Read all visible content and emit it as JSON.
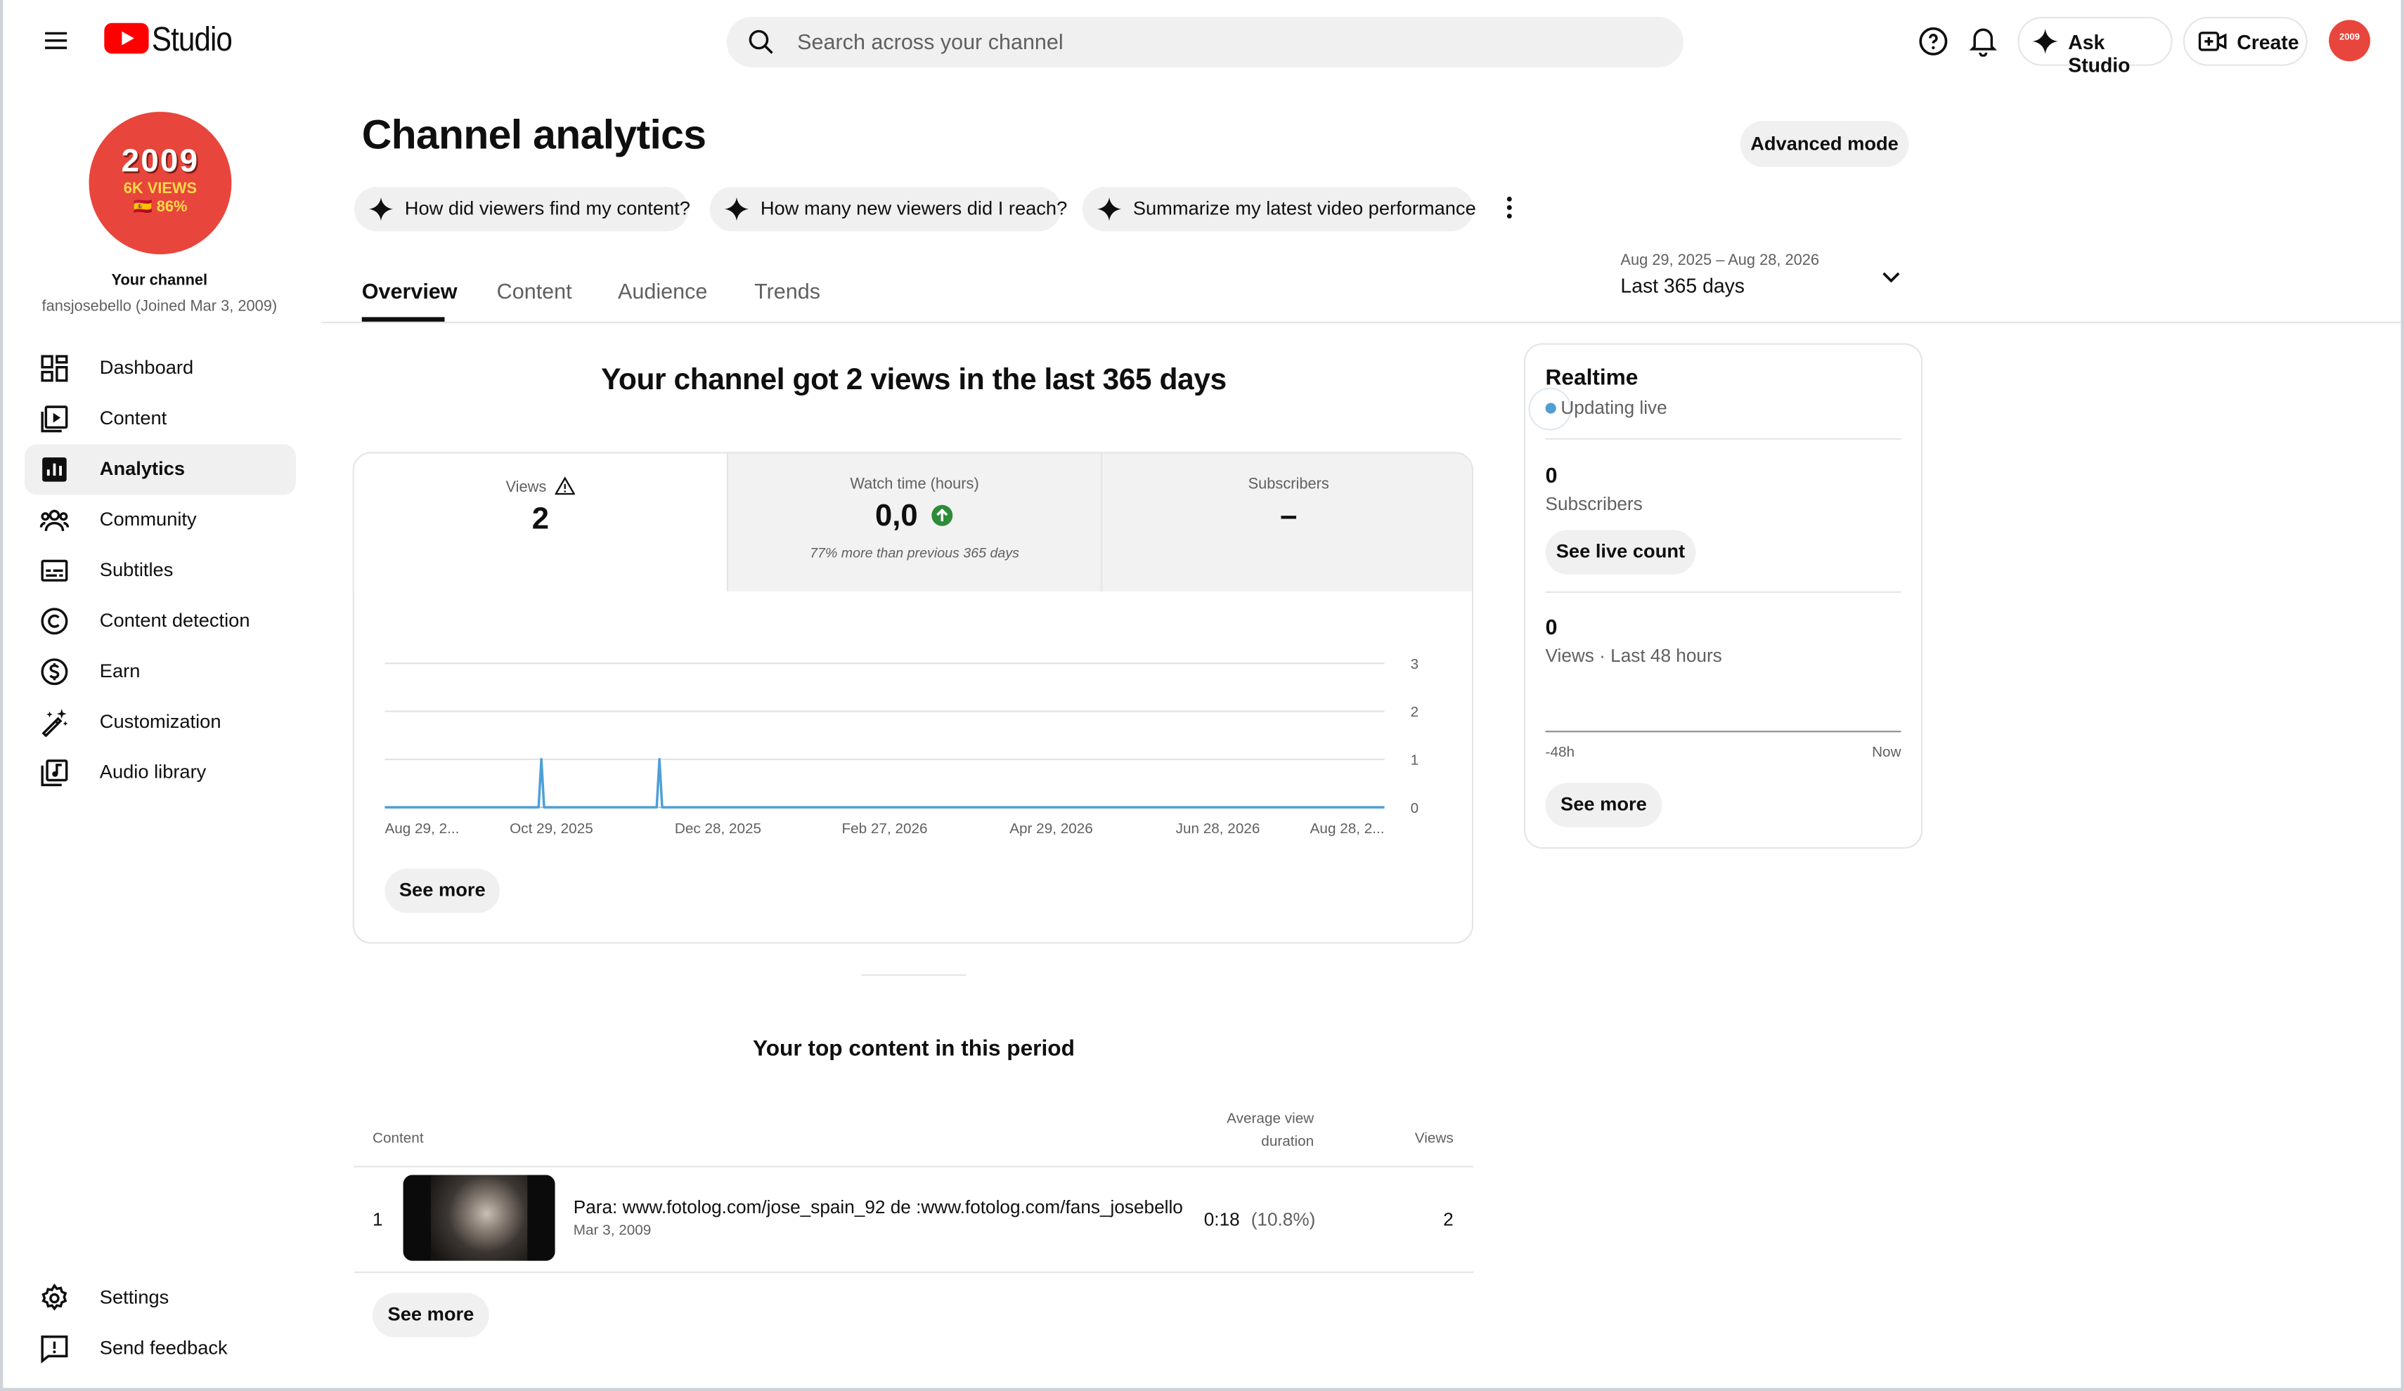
{
  "header": {
    "brand": "Studio",
    "search_placeholder": "Search across your channel",
    "ask_studio": "Ask Studio",
    "create": "Create",
    "avatar_text": "2009"
  },
  "sidebar": {
    "avatar_line1": "2009",
    "avatar_line2": "6K VIEWS",
    "avatar_line3": "🇪🇸 86%",
    "channel_label": "Your channel",
    "channel_sub": "fansjosebello (Joined Mar 3, 2009)",
    "items": [
      {
        "label": "Dashboard",
        "icon": "dashboard-icon"
      },
      {
        "label": "Content",
        "icon": "content-icon"
      },
      {
        "label": "Analytics",
        "icon": "analytics-icon"
      },
      {
        "label": "Community",
        "icon": "community-icon"
      },
      {
        "label": "Subtitles",
        "icon": "subtitles-icon"
      },
      {
        "label": "Content detection",
        "icon": "copyright-icon"
      },
      {
        "label": "Earn",
        "icon": "dollar-icon"
      },
      {
        "label": "Customization",
        "icon": "magic-wand-icon"
      },
      {
        "label": "Audio library",
        "icon": "audio-library-icon"
      }
    ],
    "settings": "Settings",
    "feedback": "Send feedback"
  },
  "main": {
    "title": "Channel analytics",
    "advanced_mode": "Advanced mode",
    "chips": [
      "How did viewers find my content?",
      "How many new viewers did I reach?",
      "Summarize my latest video performance"
    ],
    "tabs": [
      "Overview",
      "Content",
      "Audience",
      "Trends"
    ],
    "active_tab": "Overview",
    "date_range": "Aug 29, 2025 – Aug 28, 2026",
    "date_preset": "Last 365 days",
    "headline": "Your channel got 2 views in the last 365 days",
    "metrics": [
      {
        "label": "Views",
        "value": "2"
      },
      {
        "label": "Watch time (hours)",
        "value": "0,0",
        "note": "77% more than previous 365 days"
      },
      {
        "label": "Subscribers",
        "value": "–"
      }
    ],
    "see_more": "See more",
    "top_content": {
      "title": "Your top content in this period",
      "col_content": "Content",
      "col_avd_line1": "Average view",
      "col_avd_line2": "duration",
      "col_views": "Views",
      "rows": [
        {
          "rank": "1",
          "title": "Para: www.fotolog.com/jose_spain_92 de :www.fotolog.com/fans_josebello",
          "date": "Mar 3, 2009",
          "avd": "0:18",
          "avd_pct": "(10.8%)",
          "views": "2"
        }
      ],
      "see_more": "See more"
    }
  },
  "realtime": {
    "title": "Realtime",
    "status": "Updating live",
    "subs_value": "0",
    "subs_label": "Subscribers",
    "live_count": "See live count",
    "views_value": "0",
    "views_label": "Views · Last 48 hours",
    "axis_left": "-48h",
    "axis_right": "Now",
    "see_more": "See more"
  },
  "chart_data": {
    "type": "line",
    "x_ticks": [
      "Aug 29, 2...",
      "Oct 29, 2025",
      "Dec 28, 2025",
      "Feb 27, 2026",
      "Apr 29, 2026",
      "Jun 28, 2026",
      "Aug 28, 2..."
    ],
    "y_ticks": [
      "3",
      "2",
      "1",
      "0"
    ],
    "ylim": [
      0,
      3
    ],
    "series": [
      {
        "values": [
          {
            "x": "2025-10-25",
            "y": 1
          },
          {
            "x": "2025-12-07",
            "y": 1
          }
        ]
      }
    ],
    "x_range": [
      "2025-08-29",
      "2026-08-28"
    ],
    "grid": true,
    "color": "#4f9fd6"
  }
}
